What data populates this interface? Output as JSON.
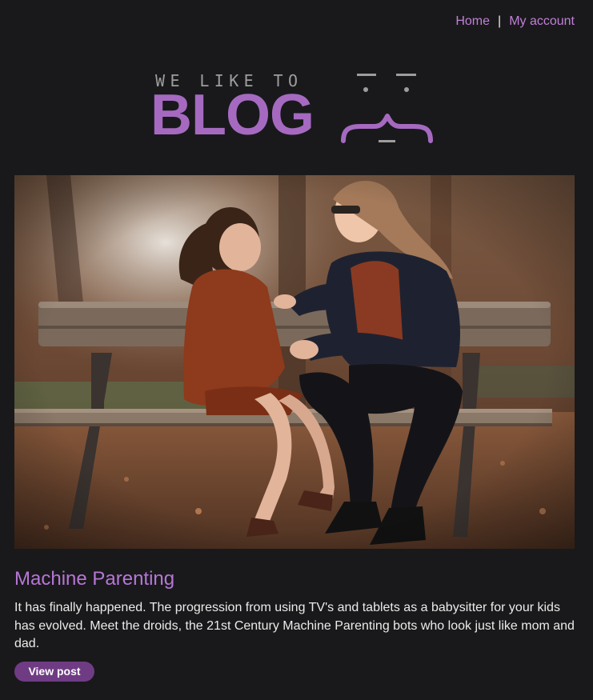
{
  "nav": {
    "home_label": "Home",
    "separator": "|",
    "account_label": "My account"
  },
  "logo": {
    "tagline": "WE LIKE TO",
    "wordmark": "BLOG",
    "brand_color": "#a56ac0"
  },
  "post": {
    "title": "Machine Parenting",
    "excerpt": "It has finally happened. The progression from using TV's and tablets as a babysitter for your kids has evolved. Meet the droids, the 21st Century Machine Parenting bots who look just like mom and dad.",
    "button_label": "View post",
    "image_subject": "mother and daughter laughing on a park bench"
  },
  "colors": {
    "background": "#19191b",
    "link": "#c27fd9",
    "button": "#6f3c84"
  }
}
